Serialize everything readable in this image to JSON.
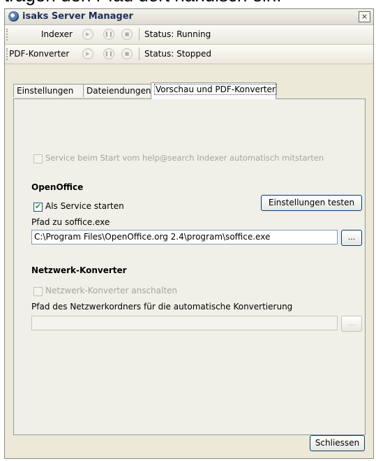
{
  "background_caption": "tragen den Pfad dort händisch ein.",
  "window": {
    "title": "isaks Server Manager",
    "close_glyph": "×"
  },
  "toolbars": [
    {
      "label": "Indexer",
      "status": "Status: Running"
    },
    {
      "label": "PDF-Konverter",
      "status": "Status: Stopped"
    }
  ],
  "tabs": [
    {
      "label": "Einstellungen"
    },
    {
      "label": "Dateiendungen"
    },
    {
      "label": "Vorschau und PDF-Konverter",
      "active": true
    }
  ],
  "panel": {
    "autostart_checkbox": {
      "label": "Service beim Start vom help@search Indexer automatisch mitstarten",
      "checked": false,
      "enabled": false
    },
    "openoffice": {
      "heading": "OpenOffice",
      "service_checkbox": {
        "label": "Als Service starten",
        "checked": true
      },
      "test_button": "Einstellungen testen",
      "path_label": "Pfad zu soffice.exe",
      "path_value": "C:\\Program Files\\OpenOffice.org 2.4\\program\\soffice.exe",
      "browse_label": "..."
    },
    "network": {
      "heading": "Netzwerk-Konverter",
      "enable_checkbox": {
        "label": "Netzwerk-Konverter anschalten",
        "checked": false,
        "enabled": false
      },
      "folder_label": "Pfad des Netzwerkordners für die automatische Konvertierung",
      "folder_value": "",
      "browse_label": "..."
    }
  },
  "close_button": "Schliessen"
}
